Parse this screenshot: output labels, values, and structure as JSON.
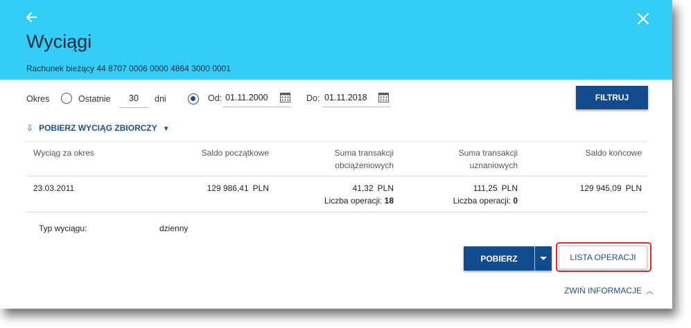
{
  "header": {
    "title": "Wyciągi",
    "account": "Rachunek bieżący 44 8707 0006 0000 4864 3000 0001",
    "bg_color": "#33cdf5"
  },
  "filter": {
    "okres_label": "Okres",
    "ostatnie_label": "Ostatnie",
    "days_value": "30",
    "dni_label": "dni",
    "od_label": "Od:",
    "od_value": "01.11.2000",
    "do_label": "Do:",
    "do_value": "01.11.2018",
    "selected_option": "od-do",
    "filtruj_label": "FILTRUJ"
  },
  "pobierz_zbiorczy": {
    "label": "POBIERZ WYCIĄG ZBIORCZY"
  },
  "table": {
    "columns": [
      "Wyciąg za okres",
      "Saldo początkowe",
      "Suma transakcji obciążeniowych",
      "Suma transakcji uznaniowych",
      "Saldo końcowe"
    ],
    "col3_line1": "Suma transakcji",
    "col3_line2": "obciążeniowych",
    "col4_line1": "Suma transakcji",
    "col4_line2": "uznaniowych",
    "row": {
      "period": "23.03.2011",
      "saldo_poczatkowe": "129 986,41",
      "obciazenia": "41,32",
      "obciazenia_ops_label": "Liczba operacji:",
      "obciazenia_ops": "18",
      "uznania": "111,25",
      "uznania_ops_label": "Liczba operacji:",
      "uznania_ops": "0",
      "saldo_koncowe": "129 945,09",
      "currency": "PLN"
    }
  },
  "details": {
    "typ_label": "Typ wyciągu:",
    "typ_value": "dzienny"
  },
  "actions": {
    "pobierz_label": "POBIERZ",
    "lista_label": "LISTA OPERACJI",
    "zwin_label": "ZWIŃ INFORMACJE",
    "accent_color": "#134c8d",
    "highlight_color": "#e02a2a"
  }
}
